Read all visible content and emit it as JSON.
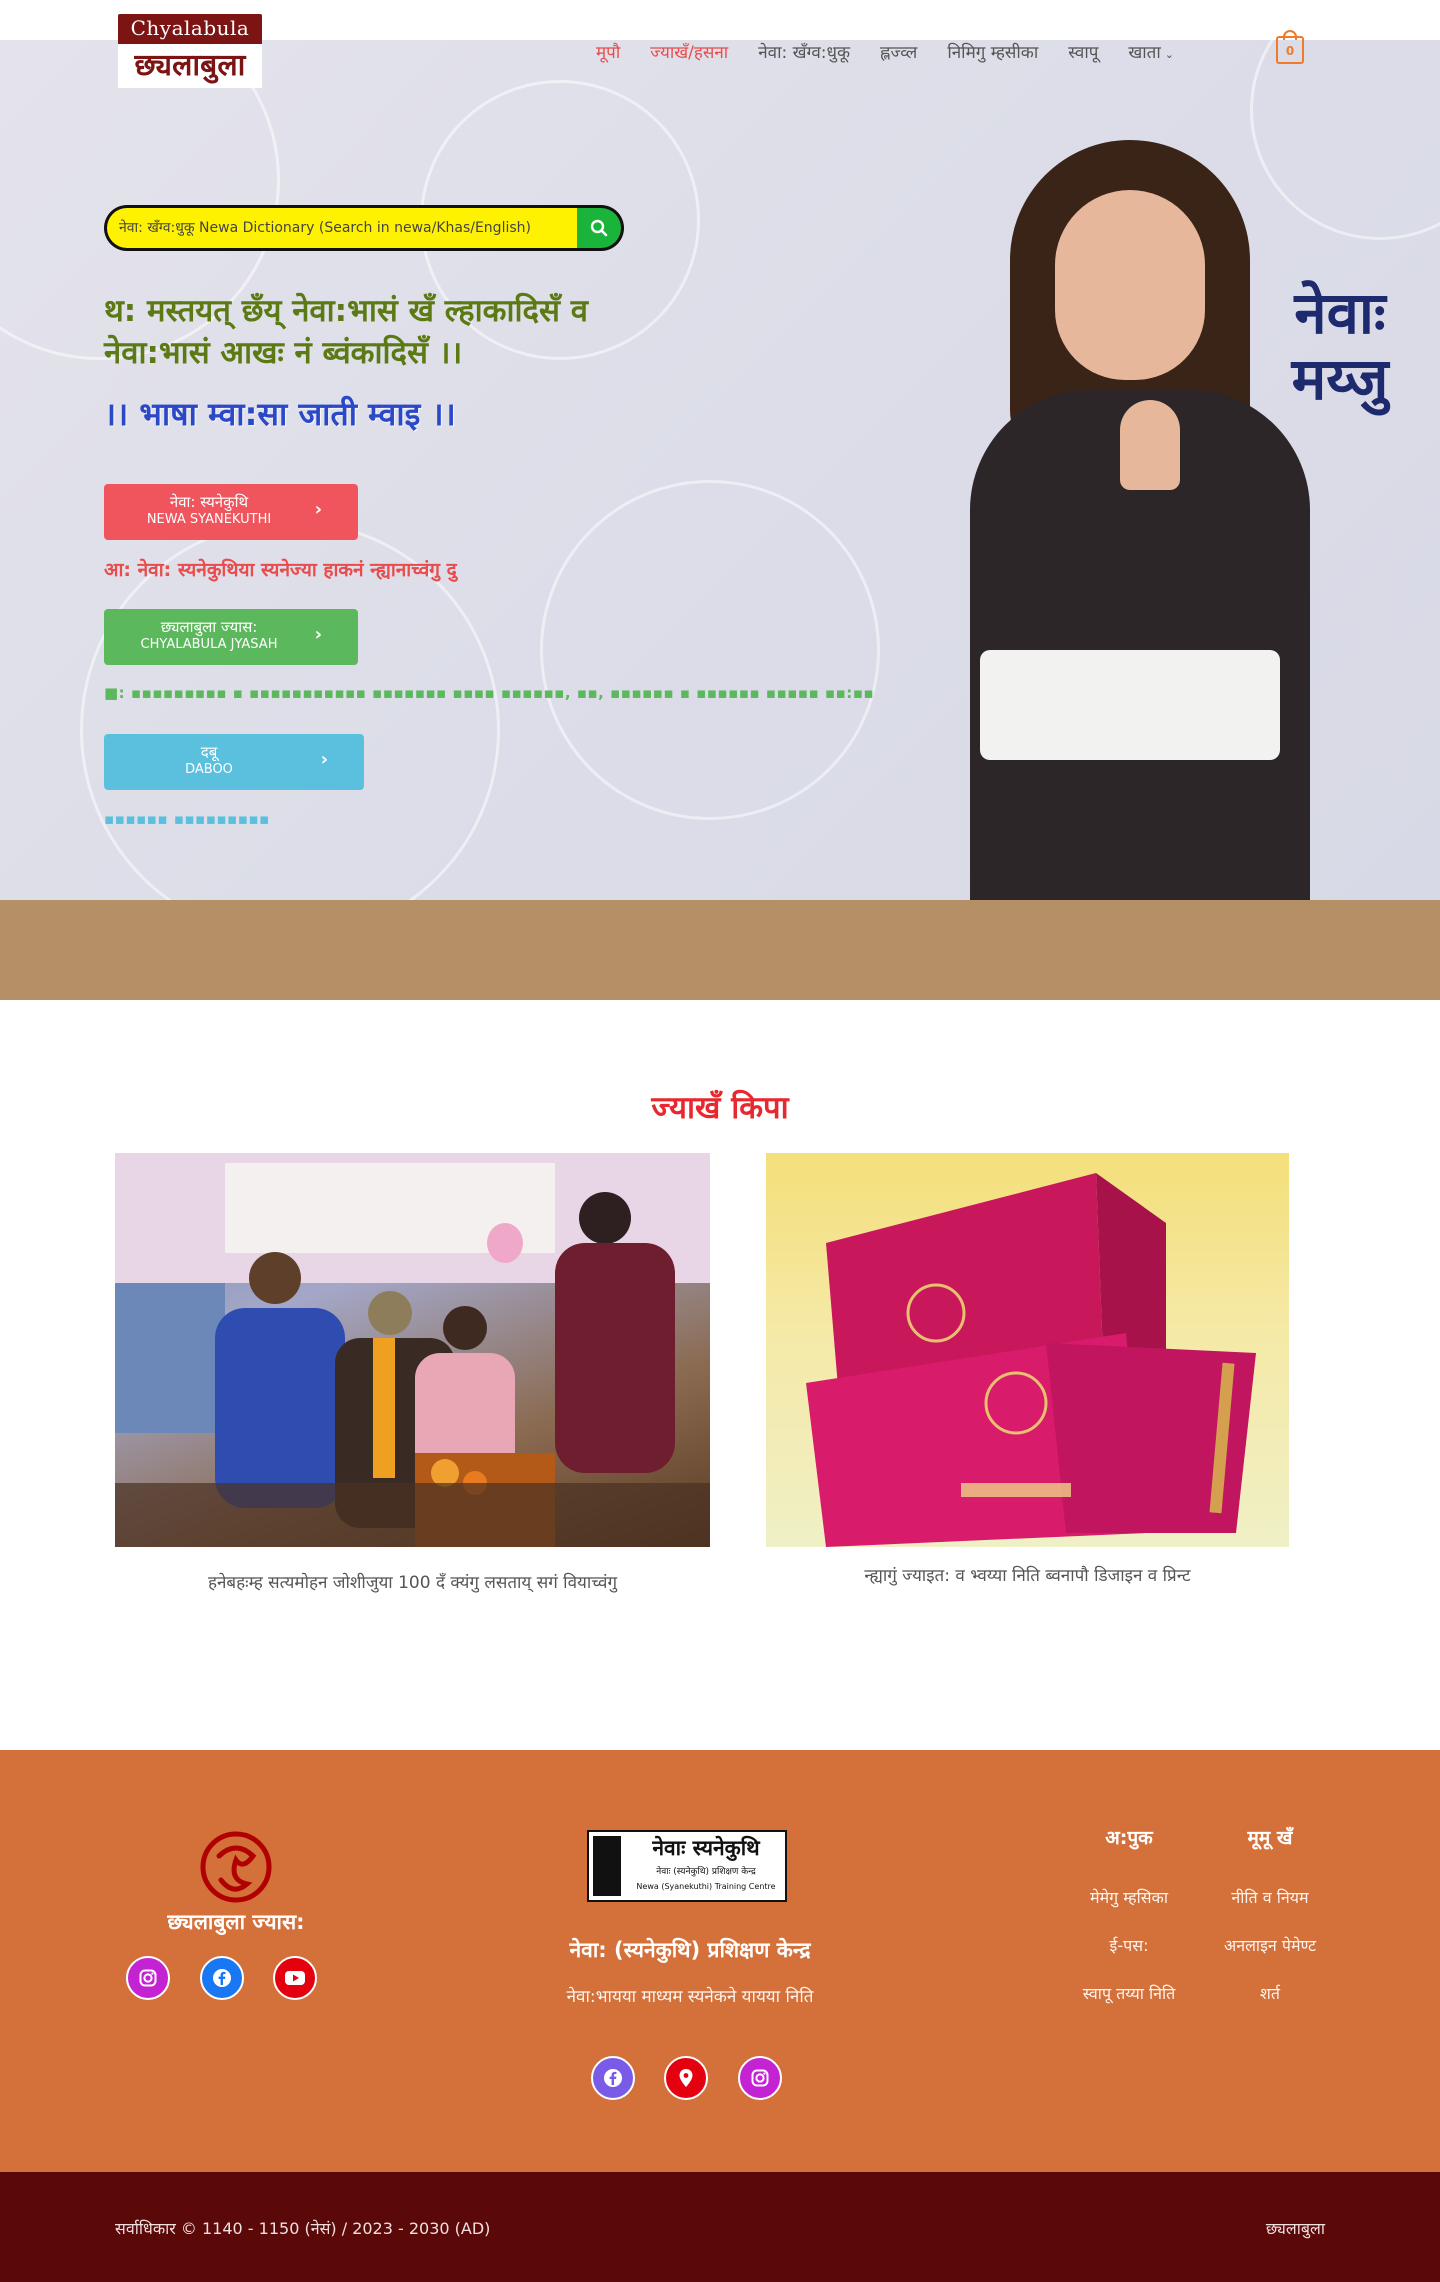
{
  "header": {
    "logo_top": "Chyalabula",
    "logo_bottom": "छ्यलाबुला",
    "nav": [
      {
        "label": "मूपौ",
        "active": true
      },
      {
        "label": "ज्याखँ/हसना",
        "active": true
      },
      {
        "label": "नेवा: खँग्व:धुकू",
        "active": false
      },
      {
        "label": "ह्लज्व्ल",
        "active": false
      },
      {
        "label": "निमिगु म्हसीका",
        "active": false
      },
      {
        "label": "स्वापू",
        "active": false
      },
      {
        "label": "खाता",
        "active": false
      }
    ],
    "cart_count": "0"
  },
  "hero": {
    "search_placeholder": "नेवा: खँग्व:धुकू Newa Dictionary (Search in newa/Khas/English)",
    "line1": "थ: मस्तयत् छँय् नेवा:भासं खँ ल्हाकादिसँ व नेवा:भासं आखः नं ब्वंकादिसँ ।।",
    "line2": "।। भाषा म्वा:सा जाती म्वाइ ।।",
    "brand_text": "नेवाः मय्जु",
    "cta_red": {
      "label": "नेवा: स्यनेकुथि",
      "sub": "NEWA SYANEKUTHI"
    },
    "note_red": "आ: नेवा: स्यनेकुथिया स्यनेज्या हाकनं न्ह्यानाच्वंगु दु",
    "cta_green": {
      "label": "छ्यलाबुला ज्यास:",
      "sub": "CHYALABULA JYASAH"
    },
    "note_green": "■: ▪▪▪▪▪▪▪▪▪ ▪ ▪▪▪▪▪▪▪▪▪▪▪ ▪▪▪▪▪▪▪ ▪▪▪▪ ▪▪▪▪▪▪, ▪▪, ▪▪▪▪▪▪ ▪ ▪▪▪▪▪▪ ▪▪▪▪▪ ▪▪:▪▪",
    "cta_blue": {
      "label": "दबू",
      "sub": "DABOO"
    },
    "note_blue": "▪▪▪▪▪▪ ▪▪▪▪▪▪▪▪▪"
  },
  "featured": {
    "title": "ज्याखँ किपा",
    "items": [
      {
        "caption": "हनेबहःम्ह सत्यमोहन जोशीजुया 100 दँ क्यंगु लसताय् सगं वियाच्वंगु"
      },
      {
        "caption": "न्ह्यागुं ज्याइत: व भ्वय्या निति ब्वनापौ डिजाइन व प्रिन्ट"
      }
    ]
  },
  "footer": {
    "left_title": "छ्यलाबुला ज्यास:",
    "mid_title": "नेवा: (स्यनेकुथि) प्रशिक्षण केन्द्र",
    "mid_sub": "नेवा:भायया माध्यम स्यनेकने यायया निति",
    "mid_logo_line1": "नेवाः स्यनेकुथि",
    "mid_logo_line2": "नेवाः (स्यनेकुथि) प्रशिक्षण केन्द्र",
    "mid_logo_line3": "Newa (Syanekuthi) Training Centre",
    "col1_title": "अ:पुक",
    "col2_title": "मूमू खँ",
    "col1_links": [
      "मेमेगु म्हसिका",
      "ई-पस:",
      "स्वापू तय्या निति"
    ],
    "col2_links": [
      "नीति व नियम",
      "अनलाइन पेमेण्ट",
      "शर्त"
    ]
  },
  "bottom": {
    "copyright": "सर्वाधिकार © 1140 - 1150 (नेसं) / 2023 - 2030 (AD)",
    "right": "छ्यलाबुला"
  },
  "colors": {
    "accent_red": "#e8282e",
    "footer_orange": "#d4703a",
    "bottom_maroon": "#5a0808"
  }
}
